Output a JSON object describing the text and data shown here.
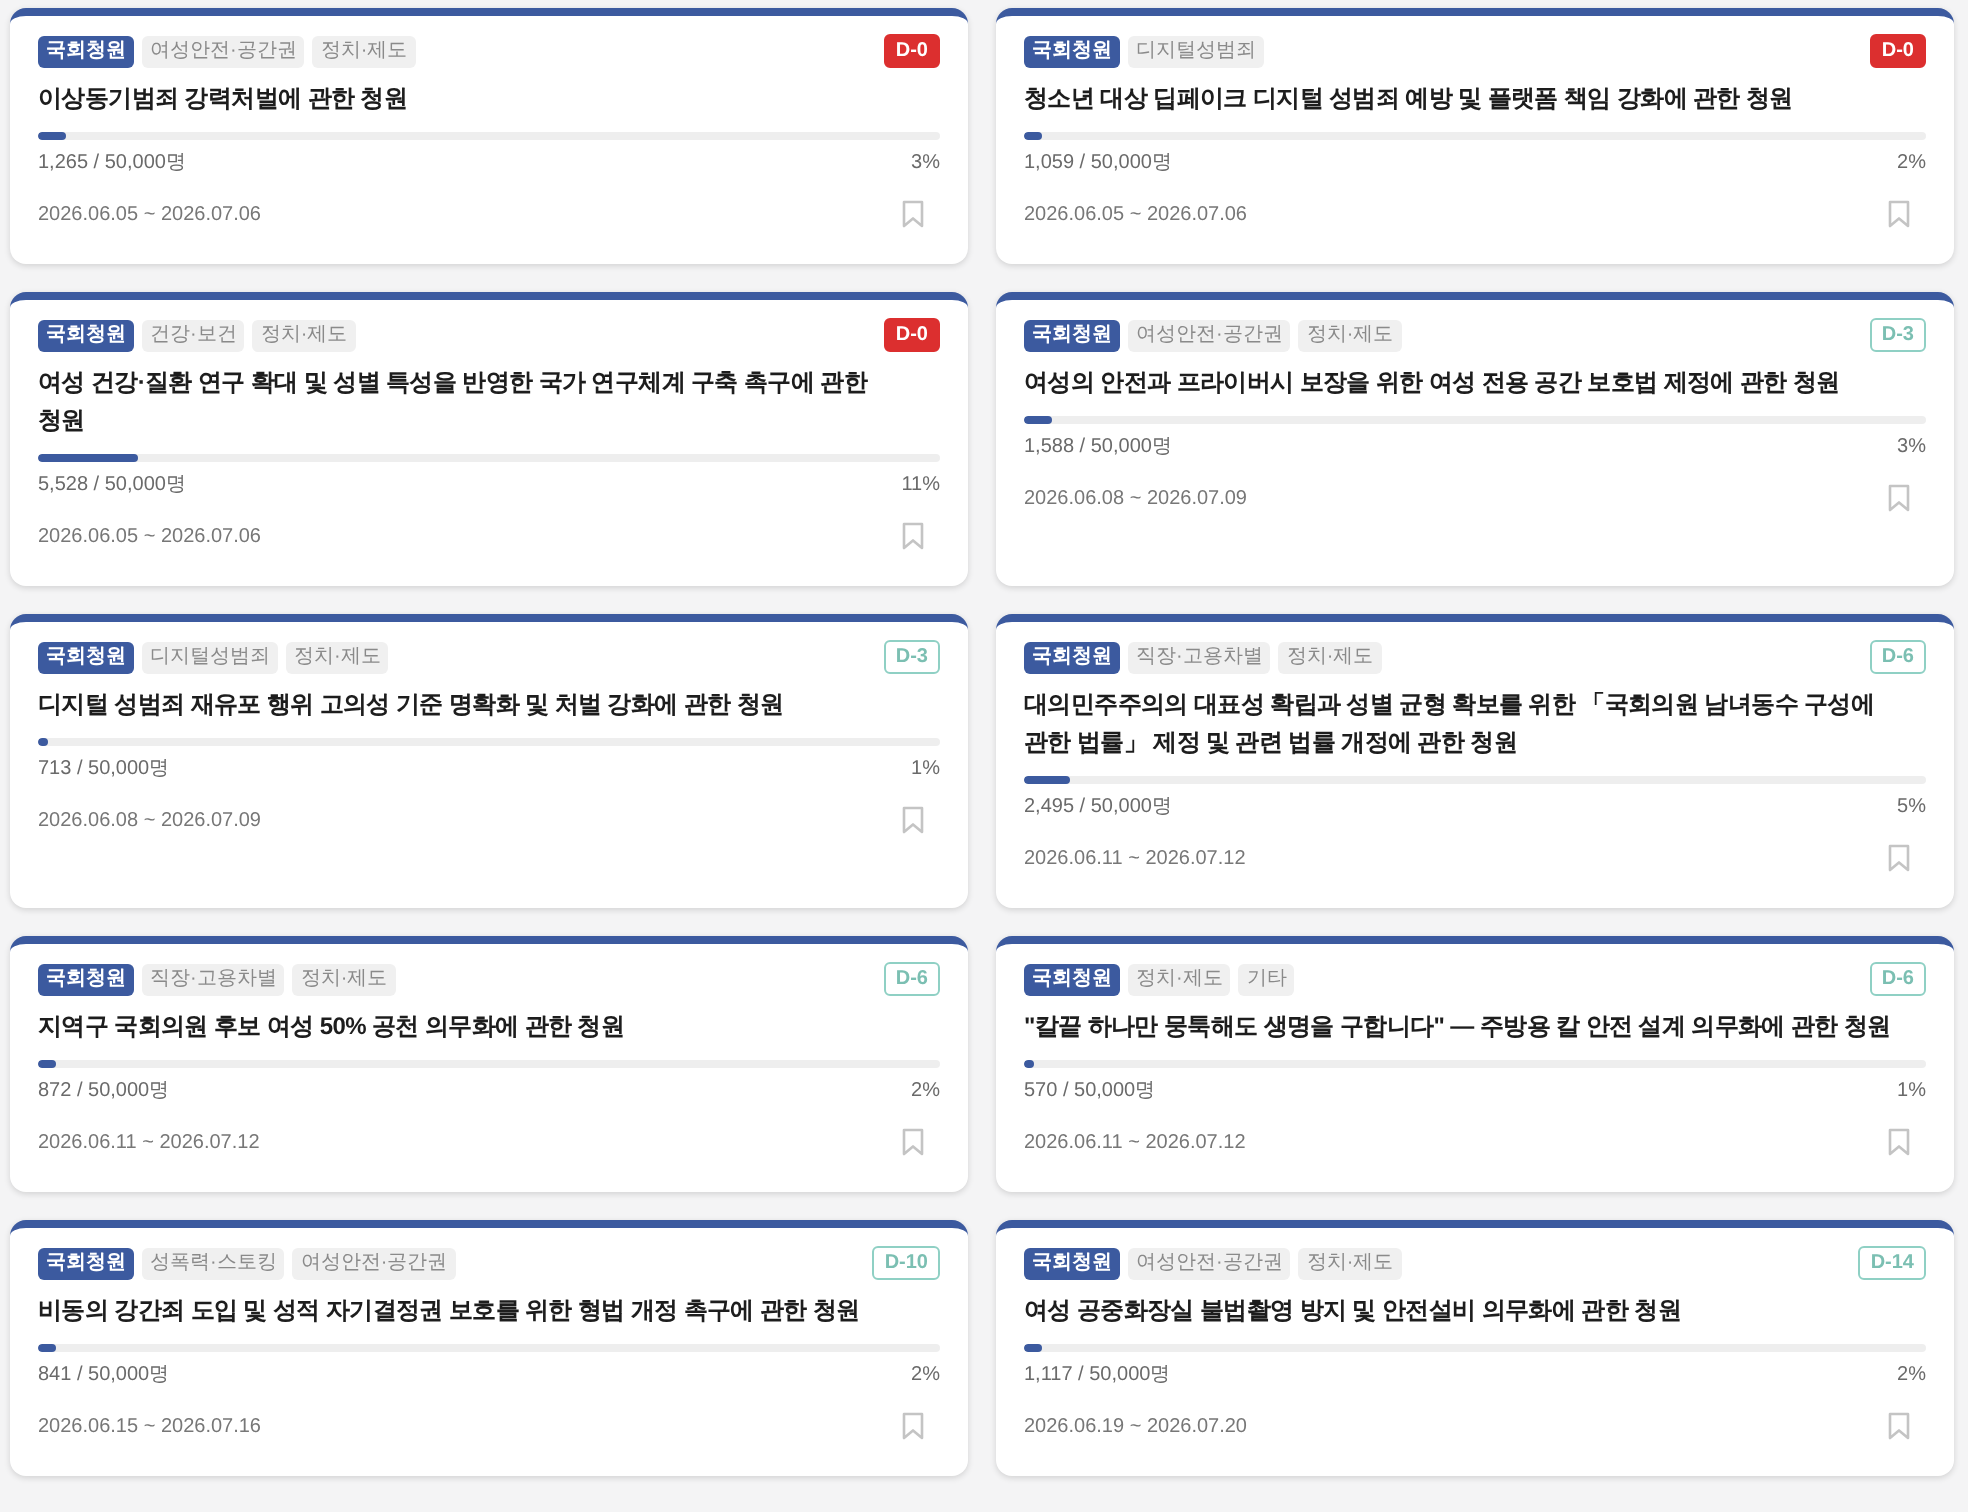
{
  "petitions": [
    {
      "source": "국회청원",
      "tags": [
        "여성안전·공간권",
        "정치·제도"
      ],
      "d_day": {
        "label": "D-0",
        "urgent": true
      },
      "title": "이상동기범죄 강력처벌에 관한 청원",
      "progress": {
        "level": 0.03,
        "count": "1,265 / 50,000명",
        "percent": "3%"
      },
      "period": "2026.06.05 ~ 2026.07.06",
      "bookmarked": false
    },
    {
      "source": "국회청원",
      "tags": [
        "디지털성범죄"
      ],
      "d_day": {
        "label": "D-0",
        "urgent": true
      },
      "title": "청소년 대상 딥페이크 디지털 성범죄 예방 및 플랫폼 책임 강화에 관한 청원",
      "progress": {
        "level": 0.02,
        "count": "1,059 / 50,000명",
        "percent": "2%"
      },
      "period": "2026.06.05 ~ 2026.07.06",
      "bookmarked": false
    },
    {
      "source": "국회청원",
      "tags": [
        "건강·보건",
        "정치·제도"
      ],
      "d_day": {
        "label": "D-0",
        "urgent": true
      },
      "title": "여성 건강·질환 연구 확대 및 성별 특성을 반영한 국가 연구체계 구축 촉구에 관한 청원",
      "progress": {
        "level": 0.11,
        "count": "5,528 / 50,000명",
        "percent": "11%"
      },
      "period": "2026.06.05 ~ 2026.07.06",
      "bookmarked": false
    },
    {
      "source": "국회청원",
      "tags": [
        "여성안전·공간권",
        "정치·제도"
      ],
      "d_day": {
        "label": "D-3",
        "urgent": false
      },
      "title": "여성의 안전과 프라이버시 보장을 위한 여성 전용 공간 보호법 제정에 관한 청원",
      "progress": {
        "level": 0.03,
        "count": "1,588 / 50,000명",
        "percent": "3%"
      },
      "period": "2026.06.08 ~ 2026.07.09",
      "bookmarked": false
    },
    {
      "source": "국회청원",
      "tags": [
        "디지털성범죄",
        "정치·제도"
      ],
      "d_day": {
        "label": "D-3",
        "urgent": false
      },
      "title": "디지털 성범죄 재유포 행위 고의성 기준 명확화 및 처벌 강화에 관한 청원",
      "progress": {
        "level": 0.01,
        "count": "713 / 50,000명",
        "percent": "1%"
      },
      "period": "2026.06.08 ~ 2026.07.09",
      "bookmarked": false
    },
    {
      "source": "국회청원",
      "tags": [
        "직장·고용차별",
        "정치·제도"
      ],
      "d_day": {
        "label": "D-6",
        "urgent": false
      },
      "title": "대의민주주의의 대표성 확립과 성별 균형 확보를 위한 「국회의원 남녀동수 구성에 관한 법률」 제정 및 관련 법률 개정에 관한 청원",
      "progress": {
        "level": 0.05,
        "count": "2,495 / 50,000명",
        "percent": "5%"
      },
      "period": "2026.06.11 ~ 2026.07.12",
      "bookmarked": false
    },
    {
      "source": "국회청원",
      "tags": [
        "직장·고용차별",
        "정치·제도"
      ],
      "d_day": {
        "label": "D-6",
        "urgent": false
      },
      "title": "지역구 국회의원 후보 여성 50% 공천 의무화에 관한 청원",
      "progress": {
        "level": 0.02,
        "count": "872 / 50,000명",
        "percent": "2%"
      },
      "period": "2026.06.11 ~ 2026.07.12",
      "bookmarked": false
    },
    {
      "source": "국회청원",
      "tags": [
        "정치·제도",
        "기타"
      ],
      "d_day": {
        "label": "D-6",
        "urgent": false
      },
      "title": "\"칼끝 하나만 뭉툭해도 생명을 구합니다\" — 주방용 칼 안전 설계 의무화에 관한 청원",
      "progress": {
        "level": 0.01,
        "count": "570 / 50,000명",
        "percent": "1%"
      },
      "period": "2026.06.11 ~ 2026.07.12",
      "bookmarked": false
    },
    {
      "source": "국회청원",
      "tags": [
        "성폭력·스토킹",
        "여성안전·공간권"
      ],
      "d_day": {
        "label": "D-10",
        "urgent": false
      },
      "title": "비동의 강간죄 도입 및 성적 자기결정권 보호를 위한 형법 개정 촉구에 관한 청원",
      "progress": {
        "level": 0.02,
        "count": "841 / 50,000명",
        "percent": "2%"
      },
      "period": "2026.06.15 ~ 2026.07.16",
      "bookmarked": false
    },
    {
      "source": "국회청원",
      "tags": [
        "여성안전·공간권",
        "정치·제도"
      ],
      "d_day": {
        "label": "D-14",
        "urgent": false
      },
      "title": "여성 공중화장실 불법촬영 방지 및 안전설비 의무화에 관한 청원",
      "progress": {
        "level": 0.02,
        "count": "1,117 / 50,000명",
        "percent": "2%"
      },
      "period": "2026.06.19 ~ 2026.07.20",
      "bookmarked": false
    }
  ]
}
